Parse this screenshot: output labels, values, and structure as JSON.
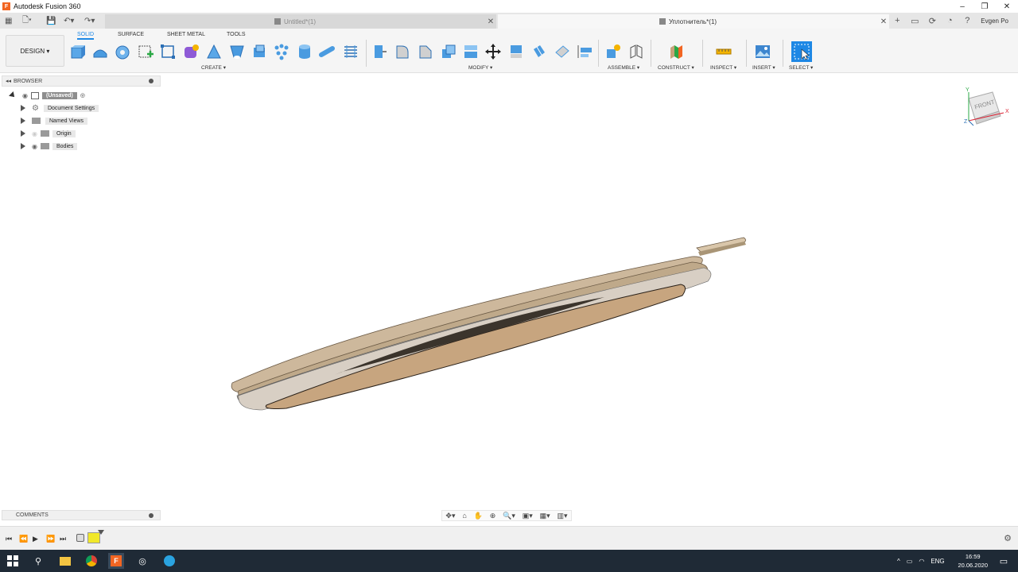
{
  "window": {
    "app_title": "Autodesk Fusion 360",
    "app_icon_letter": "F"
  },
  "tabs": [
    {
      "label": "Untitled*(1)",
      "active": false
    },
    {
      "label": "Уплотнитель*(1)",
      "active": true
    }
  ],
  "header": {
    "user_name": "Evgen Po"
  },
  "toolbar": {
    "workspace_button": "DESIGN",
    "workspace_tabs": [
      "SOLID",
      "SURFACE",
      "SHEET METAL",
      "TOOLS"
    ],
    "groups": {
      "create": "CREATE",
      "modify": "MODIFY",
      "assemble": "ASSEMBLE",
      "construct": "CONSTRUCT",
      "inspect": "INSPECT",
      "insert": "INSERT",
      "select": "SELECT"
    },
    "accent_color": "#1e88e5"
  },
  "browser": {
    "title": "BROWSER",
    "root": "(Unsaved)",
    "items": [
      {
        "label": "Document Settings",
        "icon": "gear-icon"
      },
      {
        "label": "Named Views",
        "icon": "folder-icon"
      },
      {
        "label": "Origin",
        "icon": "folder-icon"
      },
      {
        "label": "Bodies",
        "icon": "folder-icon"
      }
    ]
  },
  "viewcube": {
    "face_label": "FRONT",
    "axis_x": "X",
    "axis_y": "Y",
    "axis_z": "Z"
  },
  "comments": {
    "title": "COMMENTS"
  },
  "taskbar": {
    "language": "ENG",
    "time": "16:59",
    "date": "20.06.2020"
  }
}
